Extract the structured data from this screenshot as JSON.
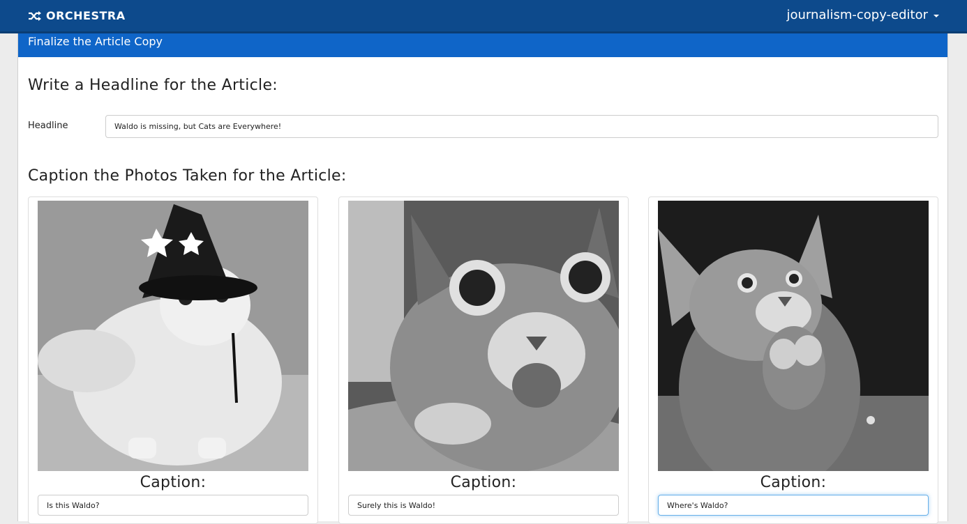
{
  "navbar": {
    "brand": "ORCHESTRA",
    "brand_icon": "shuffle-icon",
    "user": "journalism-copy-editor"
  },
  "panel": {
    "heading": "Finalize the Article Copy",
    "headline_section_title": "Write a Headline for the Article:",
    "headline_label": "Headline",
    "headline_value": "Waldo is missing, but Cats are Everywhere!",
    "photos_section_title": "Caption the Photos Taken for the Article:"
  },
  "photos": [
    {
      "image": "cat-wizard-hat-photo",
      "caption_label": "Caption:",
      "caption_value": "Is this Waldo?"
    },
    {
      "image": "cat-surprised-photo",
      "caption_label": "Caption:",
      "caption_value": "Surely this is Waldo!"
    },
    {
      "image": "kitten-praying-photo",
      "caption_label": "Caption:",
      "caption_value": "Where's Waldo?"
    }
  ],
  "colors": {
    "navbar": "#0d4a8c",
    "panel_heading": "#0f65c8",
    "focus_ring": "#66afe9"
  }
}
